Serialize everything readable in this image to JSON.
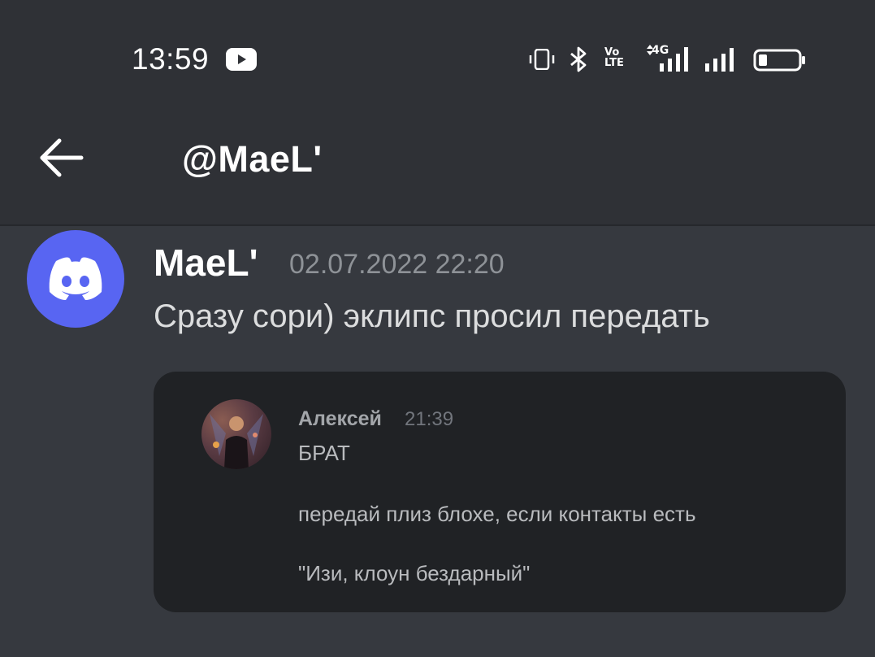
{
  "status_bar": {
    "time": "13:59",
    "network_label": "4G",
    "volte_label": "Vo LTE",
    "icons": [
      "youtube-icon",
      "vibrate-icon",
      "bluetooth-icon",
      "volte-icon",
      "signal-4g-icon",
      "signal-icon",
      "battery-icon"
    ]
  },
  "header": {
    "title": "@MaeL'",
    "back_icon": "arrow-left-icon"
  },
  "message": {
    "author": "MaeL'",
    "timestamp": "02.07.2022 22:20",
    "text": "Сразу сори) эклипс просил передать",
    "avatar_icon": "discord-logo-icon",
    "avatar_color": "#5865f2"
  },
  "embed": {
    "author": "Алексей",
    "time": "21:39",
    "lines": [
      "БРАТ",
      "передай плиз блохе, если контакты есть",
      "\"Изи, клоун бездарный\""
    ]
  },
  "colors": {
    "background": "#36393f",
    "header_bg": "#2f3136",
    "embed_bg": "#202225",
    "muted": "#8e9297"
  }
}
